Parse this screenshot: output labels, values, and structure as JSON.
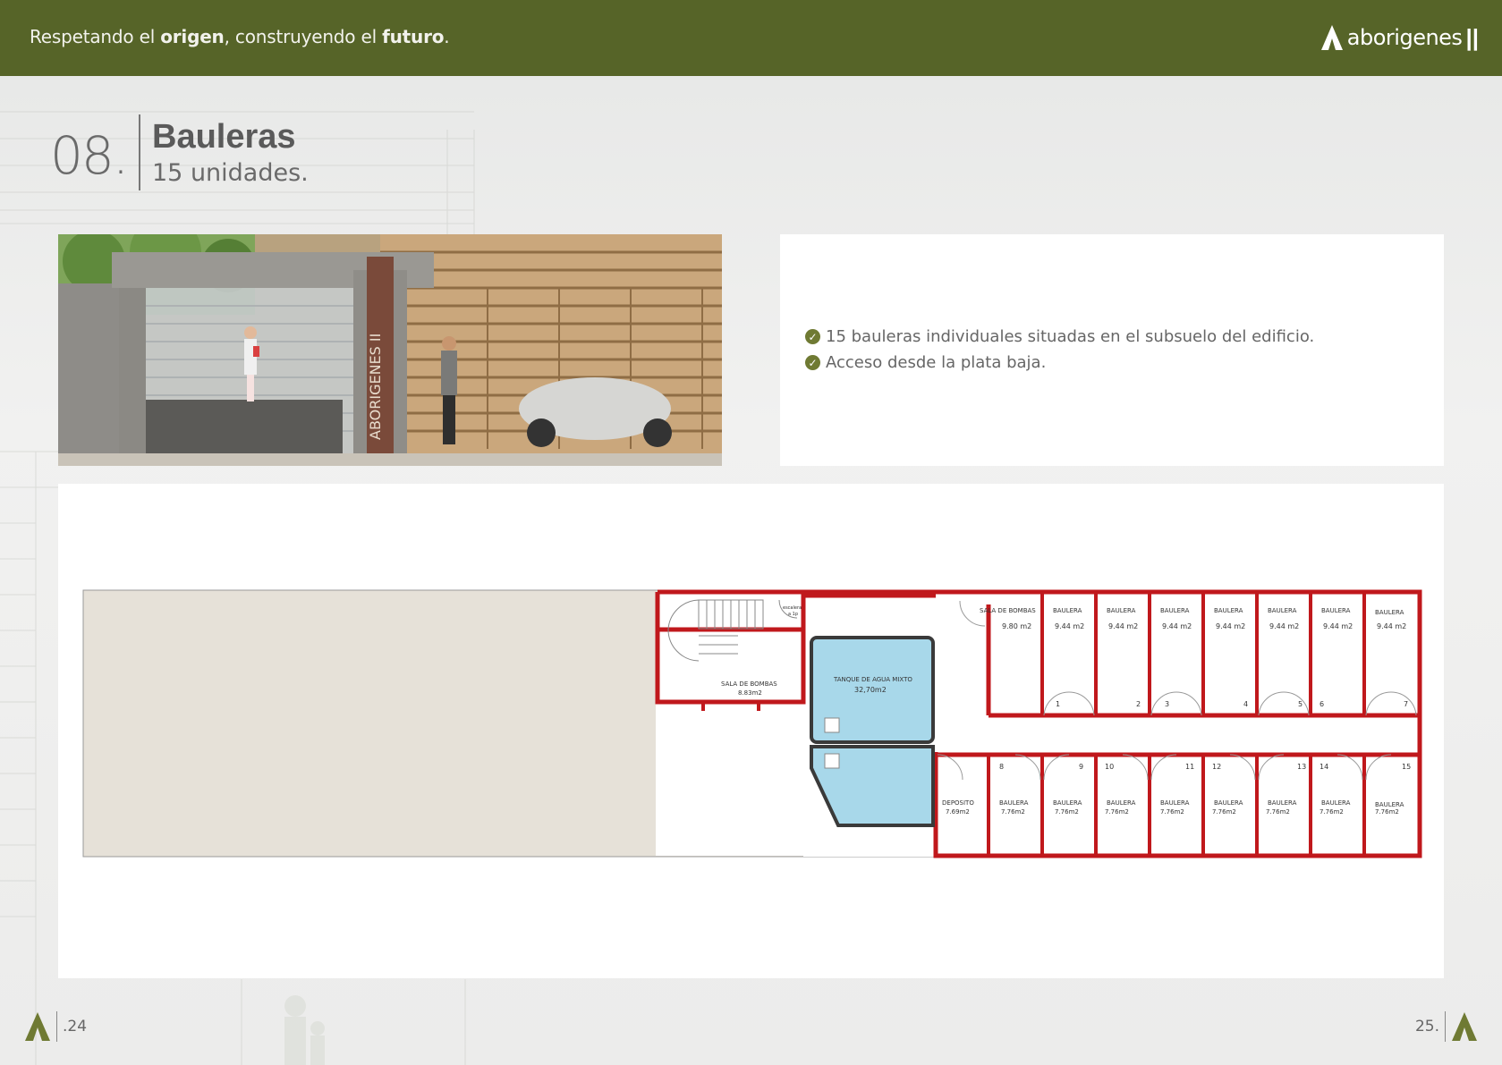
{
  "header": {
    "tagline_1": "Respetando el ",
    "tagline_2": "origen",
    "tagline_3": ", construyendo el ",
    "tagline_4": "futuro",
    "tagline_5": ".",
    "brand": "aborigenes",
    "brand_suffix": "||",
    "bar_color": "#566428"
  },
  "section": {
    "number": "08.",
    "title": "Bauleras",
    "subtitle": "15 unidades."
  },
  "photo": {
    "sign_text": "ABORIGENES II"
  },
  "bullets": [
    "15 bauleras individuales situadas en el subsuelo del edificio.",
    "Acceso desde la plata baja."
  ],
  "plan": {
    "top_rooms": [
      {
        "name": "SALA DE BOMBAS",
        "area": "9.80 m2"
      },
      {
        "name": "BAULERA",
        "area": "9.44 m2"
      },
      {
        "name": "BAULERA",
        "area": "9.44 m2"
      },
      {
        "name": "BAULERA",
        "area": "9.44 m2"
      },
      {
        "name": "BAULERA",
        "area": "9.44 m2"
      },
      {
        "name": "BAULERA",
        "area": "9.44 m2"
      },
      {
        "name": "BAULERA",
        "area": "9.44 m2"
      },
      {
        "name": "BAULERA",
        "area": "9.44 m2"
      }
    ],
    "top_numbers": [
      "1",
      "2",
      "3",
      "4",
      "5",
      "6",
      "7"
    ],
    "bottom_rooms": [
      {
        "name": "DEPOSITO",
        "area": "7.69m2"
      },
      {
        "name": "BAULERA",
        "area": "7.76m2"
      },
      {
        "name": "BAULERA",
        "area": "7.76m2"
      },
      {
        "name": "BAULERA",
        "area": "7.76m2"
      },
      {
        "name": "BAULERA",
        "area": "7.76m2"
      },
      {
        "name": "BAULERA",
        "area": "7.76m2"
      },
      {
        "name": "BAULERA",
        "area": "7.76m2"
      },
      {
        "name": "BAULERA",
        "area": "7.76m2"
      },
      {
        "name": "BAULERA",
        "area": "7.76m2"
      }
    ],
    "bottom_numbers": [
      "8",
      "9",
      "10",
      "11",
      "12",
      "13",
      "14",
      "15"
    ],
    "pump_room": {
      "name": "SALA DE BOMBAS",
      "area": "8.83m2"
    },
    "tank": {
      "name": "TANQUE DE AGUA MIXTO",
      "area": "32,70m2"
    },
    "stairs_label_1": "escalera",
    "stairs_label_2": "a 1p",
    "wall_color": "#c0181c",
    "tank_color": "#a8d8ea"
  },
  "footer": {
    "page_left": ".24",
    "page_right": "25."
  }
}
